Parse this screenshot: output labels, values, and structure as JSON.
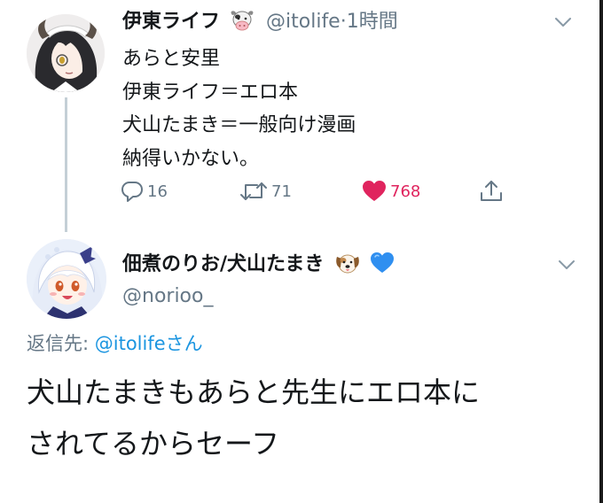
{
  "tweet1": {
    "display_name": "伊東ライフ",
    "name_emoji": "cow-face",
    "handle": "@itolife",
    "separator": "·",
    "time": "1時間",
    "body_lines": [
      "あらと安里",
      "伊東ライフ＝エロ本",
      "犬山たまき＝一般向け漫画",
      "納得いかない。"
    ],
    "replies": "16",
    "retweets": "71",
    "likes": "768",
    "liked": true
  },
  "tweet2": {
    "display_name": "佃煮のりお/犬山たまき",
    "name_emojis": [
      "dog-face",
      "blue-heart"
    ],
    "handle": "@norioo_",
    "reply_to_label": "返信先: ",
    "reply_to_mention": "@itolife",
    "reply_to_suffix": "さん",
    "body_lines": [
      "犬山たまきもあらと先生にエロ本に",
      "されてるからセーフ"
    ]
  },
  "colors": {
    "text": "#14171a",
    "muted": "#657786",
    "link": "#1b95e0",
    "like": "#e0245e",
    "thread_line": "#c4cfd6"
  }
}
